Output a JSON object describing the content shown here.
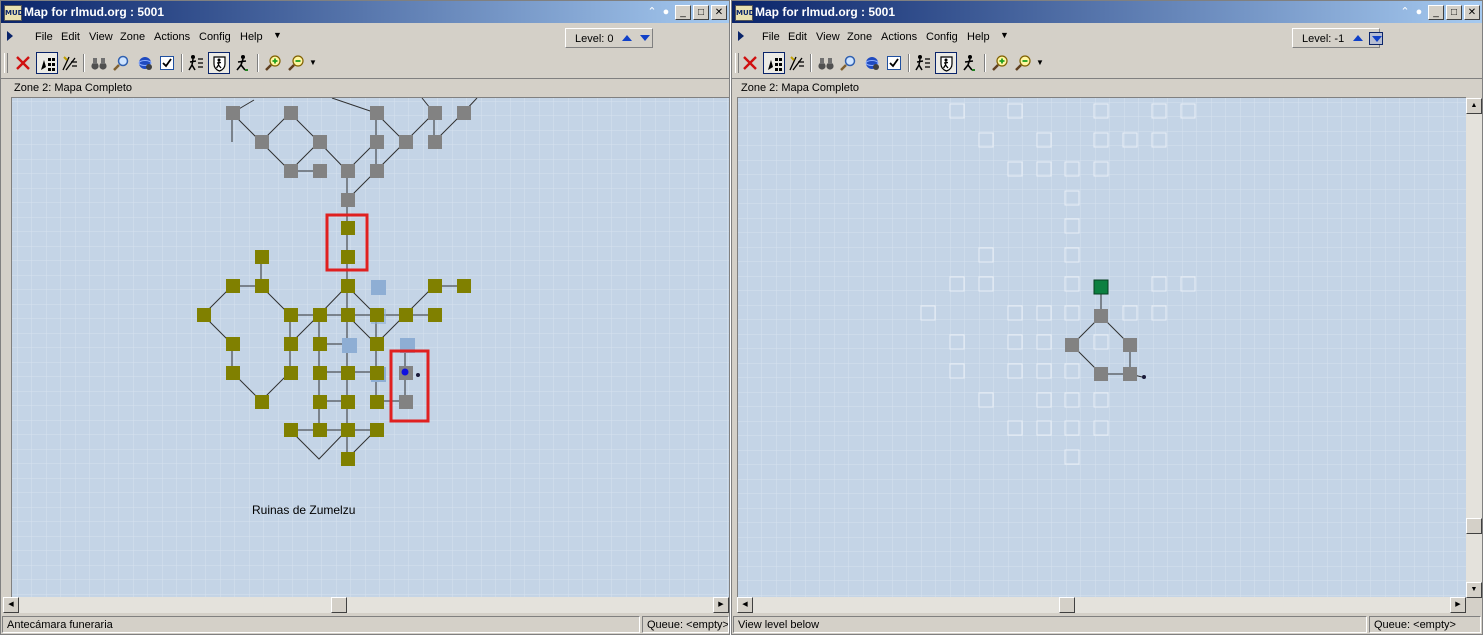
{
  "windows": [
    {
      "title": "Map for rlmud.org : 5001",
      "menu": [
        "File",
        "Edit",
        "View",
        "Zone",
        "Actions",
        "Config",
        "Help"
      ],
      "level_label": "Level: 0",
      "zone_label": "Zone 2: Mapa Completo",
      "map_label": "Ruinas de Zumelzu",
      "status_left": "Antecámara funeraria",
      "status_right": "Queue: <empty>"
    },
    {
      "title": "Map for rlmud.org : 5001",
      "menu": [
        "File",
        "Edit",
        "View",
        "Zone",
        "Actions",
        "Config",
        "Help"
      ],
      "level_label": "Level: -1",
      "zone_label": "Zone 2: Mapa Completo",
      "status_left": "View level below",
      "status_right": "Queue: <empty>"
    }
  ],
  "icons": {
    "app": "mud-app-icon",
    "toolbar": [
      "delete-icon",
      "select-rooms-icon",
      "draw-exits-icon",
      "find-room-icon",
      "magnify-icon",
      "locate-player-icon",
      "check-icon",
      "walk-icon",
      "shield-walk-icon",
      "runner-icon",
      "zoom-in-icon",
      "zoom-out-icon"
    ]
  },
  "app_icon_text": "MUD",
  "colors": {
    "map_background": "#c4d4e6",
    "room_olive": "#808000",
    "room_gray": "#828282",
    "room_current_level_below": "#0c8040",
    "highlight_box": "#e02020",
    "player_marker": "#1010e0"
  }
}
